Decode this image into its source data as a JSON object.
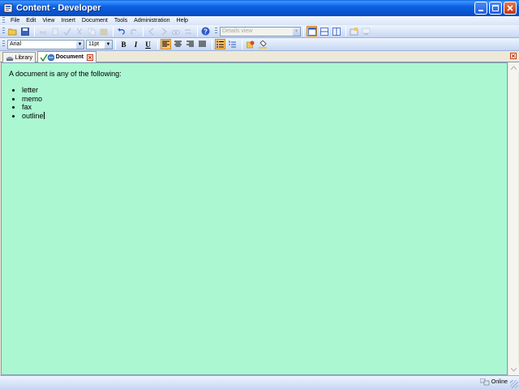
{
  "window": {
    "title": "Content - Developer"
  },
  "menu": [
    {
      "label": "File"
    },
    {
      "label": "Edit"
    },
    {
      "label": "View"
    },
    {
      "label": "Insert"
    },
    {
      "label": "Document"
    },
    {
      "label": "Tools"
    },
    {
      "label": "Administration"
    },
    {
      "label": "Help"
    }
  ],
  "toolbar1": {
    "view_combo": "Details view"
  },
  "toolbar2": {
    "font_name": "Arial",
    "font_size": "11pt",
    "bold": "B",
    "italic": "I",
    "underline": "U"
  },
  "tabs": [
    {
      "label": "Library"
    },
    {
      "label": "Document"
    }
  ],
  "document": {
    "intro": "A document is any of the following:",
    "items": [
      "letter",
      "memo",
      "fax",
      "outline"
    ]
  },
  "status": {
    "connection": "Online"
  }
}
